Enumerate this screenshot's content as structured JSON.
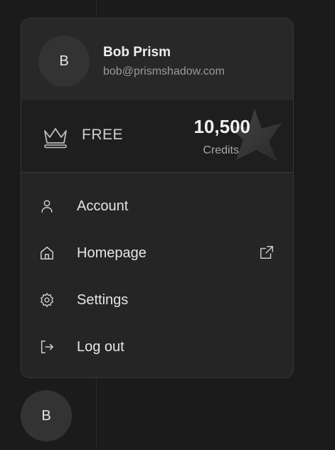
{
  "user": {
    "initial": "B",
    "name": "Bob Prism",
    "email": "bob@prismshadow.com"
  },
  "plan": {
    "name": "FREE",
    "credits_value": "10,500",
    "credits_label": "Credits",
    "icon": "crown-icon"
  },
  "menu": {
    "items": [
      {
        "label": "Account",
        "icon": "user-icon"
      },
      {
        "label": "Homepage",
        "icon": "home-icon",
        "trailing_icon": "external-link-icon"
      },
      {
        "label": "Settings",
        "icon": "gear-icon"
      },
      {
        "label": "Log out",
        "icon": "logout-icon"
      }
    ]
  },
  "sidebar": {
    "avatar_initial": "B"
  },
  "colors": {
    "background": "#1b1b1b",
    "panel": "#252525",
    "plan_row": "#1e1e1e",
    "text": "#e6e6e6",
    "muted": "#9a9a9a"
  }
}
